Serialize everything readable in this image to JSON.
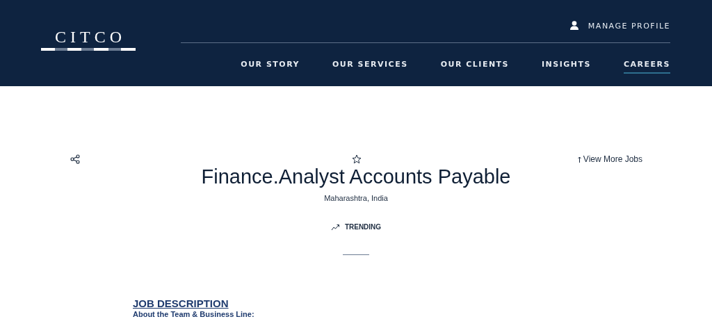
{
  "header": {
    "logo": "CITCO",
    "manage_profile": "MANAGE PROFILE",
    "nav": [
      {
        "label": "OUR STORY",
        "selected": false
      },
      {
        "label": "OUR SERVICES",
        "selected": false
      },
      {
        "label": "OUR CLIENTS",
        "selected": false
      },
      {
        "label": "INSIGHTS",
        "selected": false
      },
      {
        "label": "CAREERS",
        "selected": true
      }
    ]
  },
  "job": {
    "view_more": "View More Jobs",
    "title": "Finance.Analyst Accounts Payable",
    "location": "Maharashtra, India",
    "trending": "TRENDING"
  },
  "description": {
    "heading": "JOB DESCRIPTION",
    "subheading": "About the Team & Business Line:"
  }
}
